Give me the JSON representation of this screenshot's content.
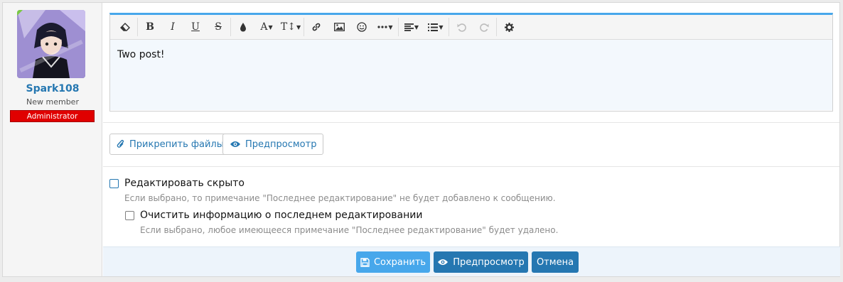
{
  "user": {
    "name": "Spark108",
    "title": "New member",
    "role": "Administrator"
  },
  "editor": {
    "content": "Two post!",
    "toolbar": [
      "eraser-icon",
      "bold-icon",
      "italic-icon",
      "underline-icon",
      "strikethrough-icon",
      "color-icon",
      "font-family-icon",
      "font-size-icon",
      "link-icon",
      "image-icon",
      "smiley-icon",
      "more-icon",
      "align-icon",
      "list-icon",
      "undo-icon",
      "redo-icon",
      "settings-icon"
    ]
  },
  "attach": {
    "attach_label": "Прикрепить файлы",
    "preview_label": "Предпросмотр"
  },
  "options": {
    "silent_label": "Редактировать скрыто",
    "silent_hint": "Если выбрано, то примечание \"Последнее редактирование\" не будет добавлено к сообщению.",
    "clear_label": "Очистить информацию о последнем редактировании",
    "clear_hint": "Если выбрано, любое имеющееся примечание \"Последнее редактирование\" будет удалено."
  },
  "footer": {
    "save_label": "Сохранить",
    "preview_label": "Предпросмотр",
    "cancel_label": "Отмена"
  },
  "colors": {
    "accent": "#47a7eb",
    "link": "#2577b1",
    "save": "#47a7eb",
    "primary": "#2577b1",
    "badge": "#e00000"
  }
}
